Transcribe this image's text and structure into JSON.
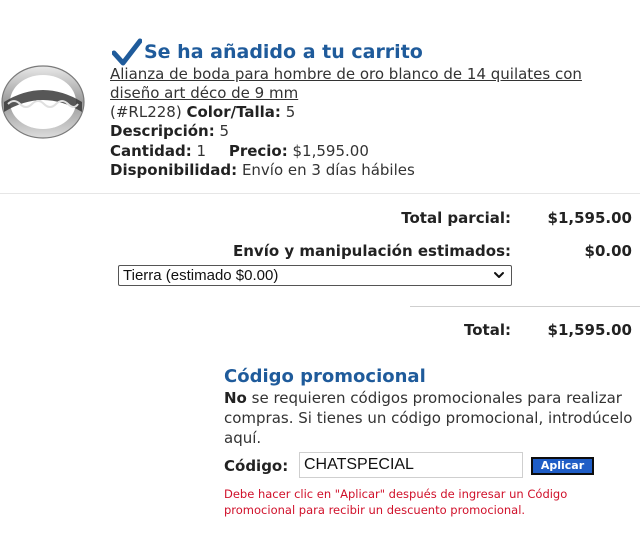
{
  "cart": {
    "added_message": "Se ha añadido a tu carrito",
    "product": {
      "name": "Alianza de boda para hombre de oro blanco de 14 quilates con diseño art déco de 9 mm",
      "sku": "(#RL228)",
      "color_size_label": "Color/Talla:",
      "color_size_value": "5",
      "description_label": "Descripción:",
      "description_value": "5",
      "quantity_label": "Cantidad:",
      "quantity_value": "1",
      "price_label": "Precio:",
      "price_value": "$1,595.00",
      "availability_label": "Disponibilidad:",
      "availability_value": "Envío en 3 días hábiles"
    }
  },
  "totals": {
    "subtotal_label": "Total parcial:",
    "subtotal_value": "$1,595.00",
    "shipping_label": "Envío y manipulación estimados:",
    "shipping_value": "$0.00",
    "shipping_option_selected": "Tierra (estimado $0.00)",
    "total_label": "Total:",
    "total_value": "$1,595.00"
  },
  "promo": {
    "title": "Código promocional",
    "text_bold": "No",
    "text_rest": " se requieren códigos promocionales para realizar compras. Si tienes un código promocional, introdúcelo aquí.",
    "code_label": "Código:",
    "code_value": "CHATSPECIAL",
    "apply_label": "Aplicar",
    "warning": "Debe hacer clic en \"Aplicar\" después de ingresar un Código promocional para recibir un descuento promocional."
  },
  "colors": {
    "accent_blue": "#1f5b9b",
    "button_blue": "#1f5dc6",
    "warning_red": "#d0102a"
  },
  "icons": [
    "checkmark-icon",
    "chevron-down-icon",
    "ring-product-image"
  ]
}
